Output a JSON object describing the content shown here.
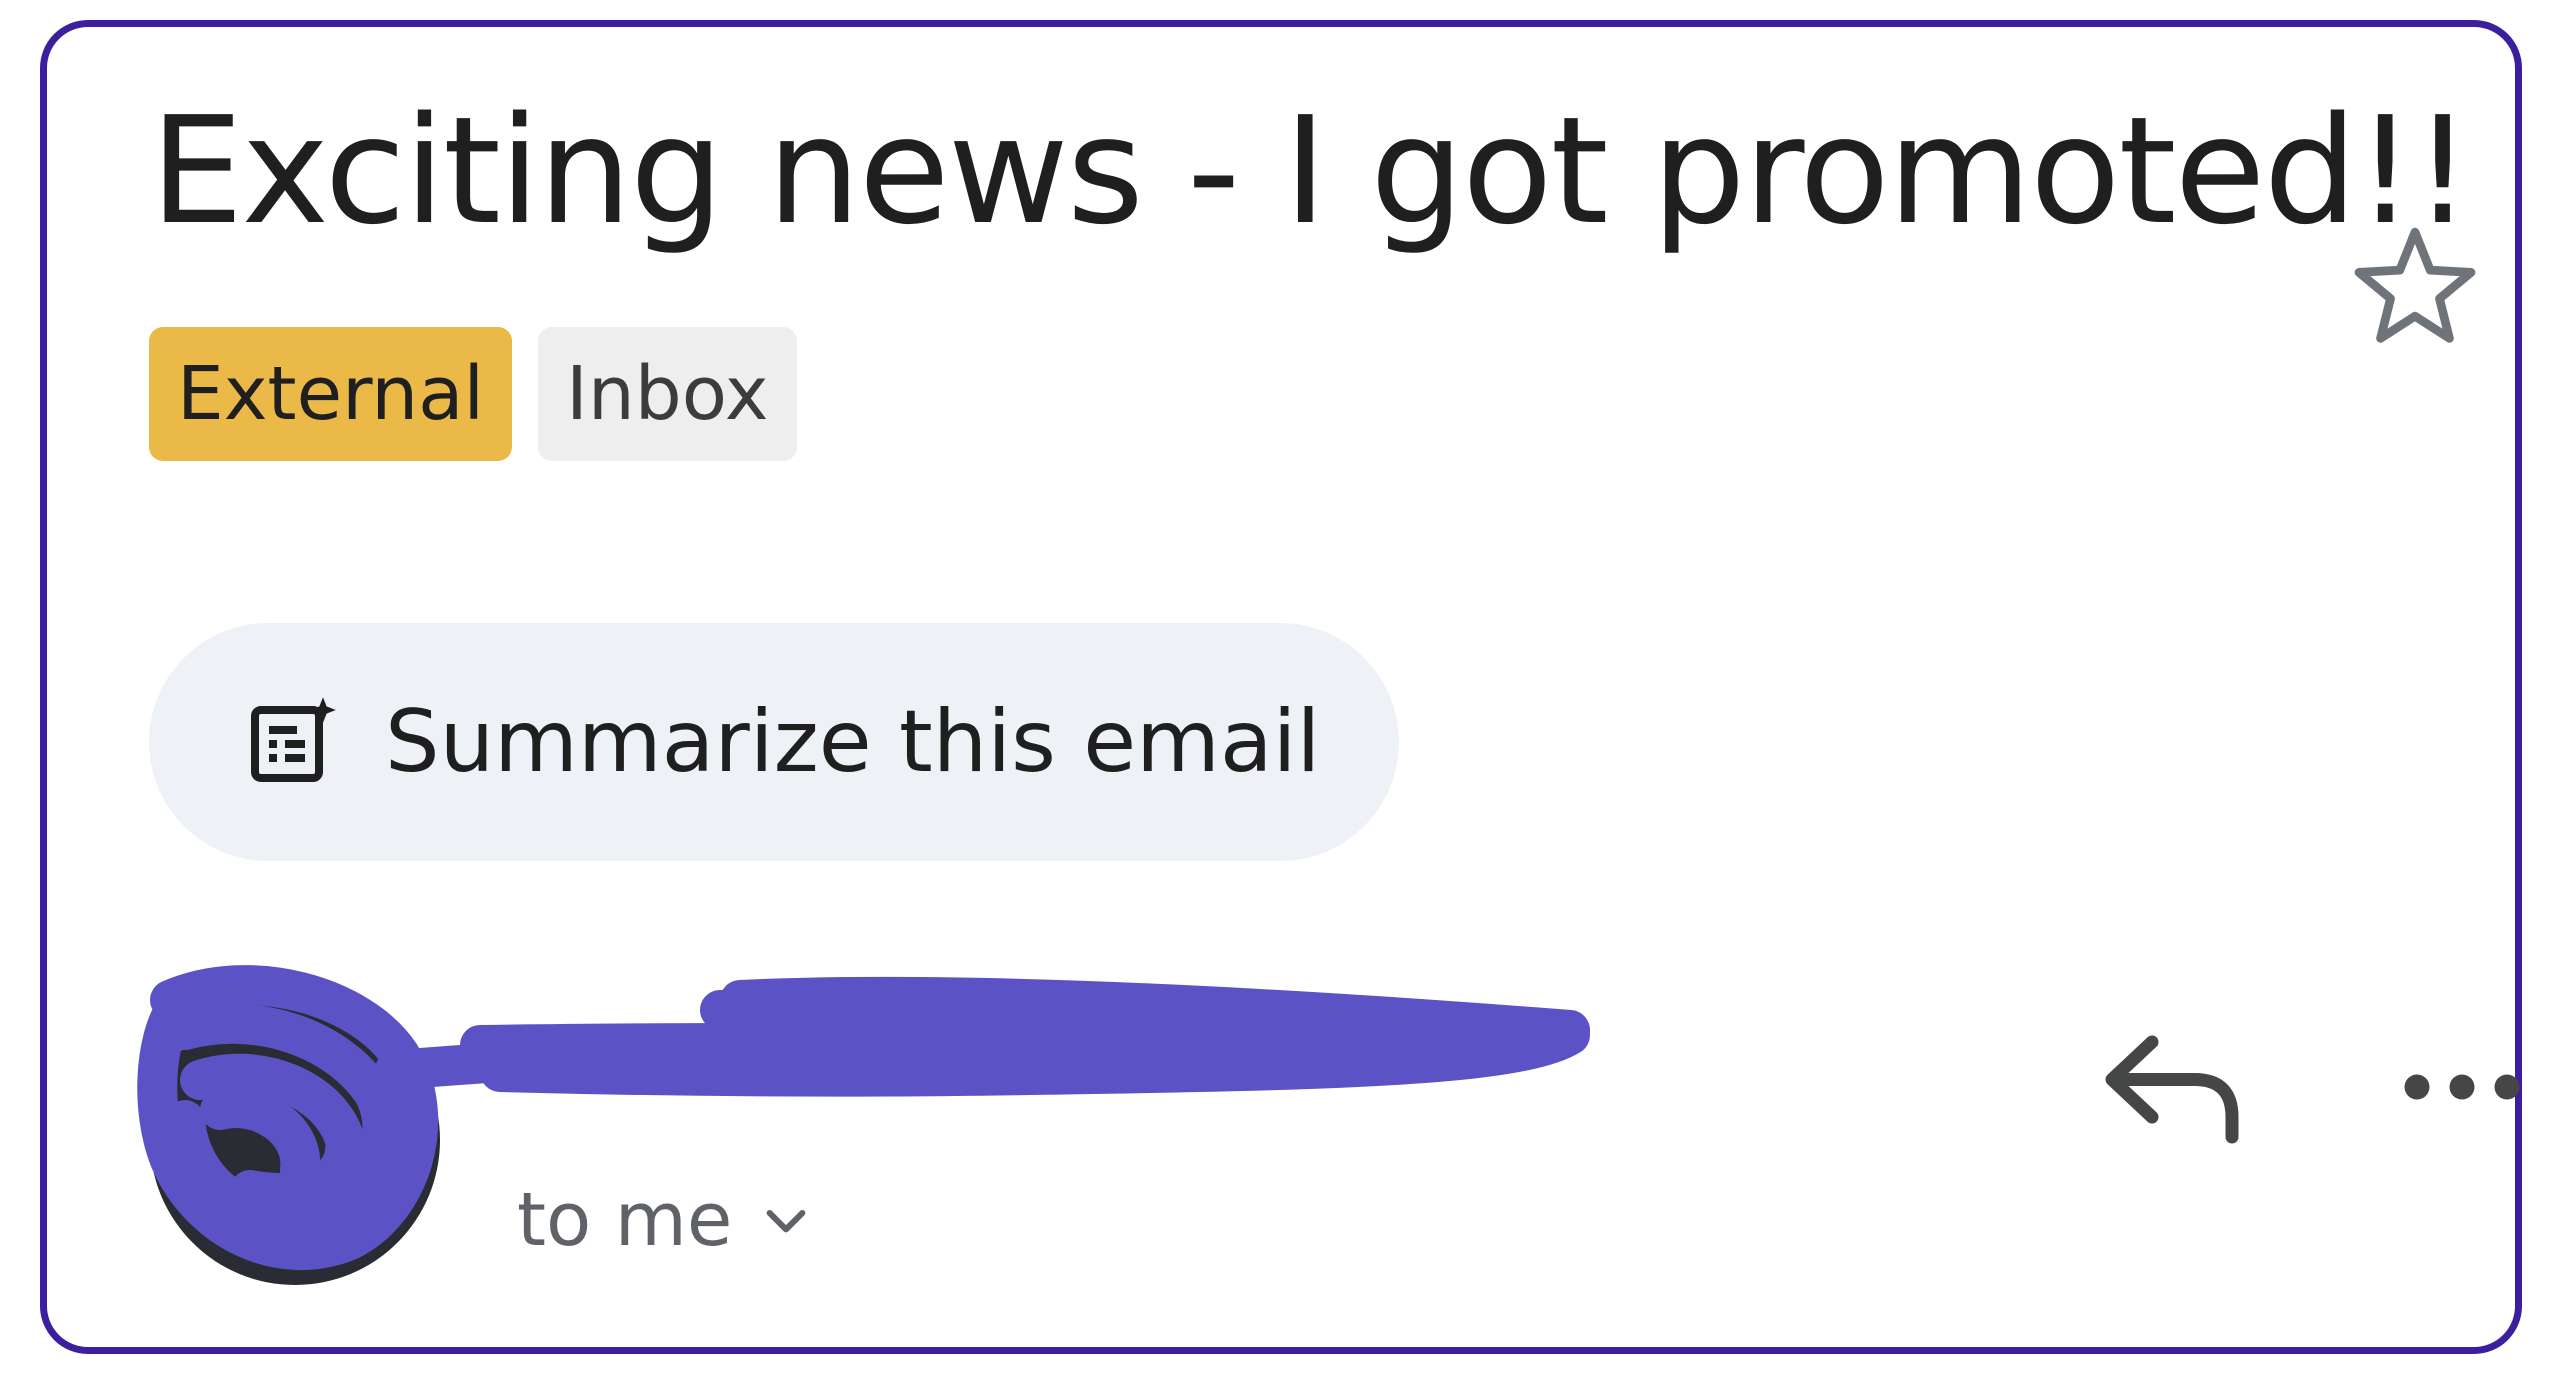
{
  "email": {
    "subject": "Exciting news - I got promoted!!",
    "labels": [
      "External",
      "Inbox"
    ],
    "summarize_label": "Summarize this email",
    "recipient_text": "to me"
  },
  "colors": {
    "frame_border": "#3b1f9e",
    "external_label_bg": "#ebb947",
    "inbox_label_bg": "#eeeeee",
    "summarize_bg": "#eef2f7",
    "redaction": "#5b52c6"
  },
  "icons": {
    "star": "star-outline-icon",
    "summarize": "summarize-sparkle-icon",
    "recipient_toggle": "chevron-down-icon",
    "reply": "reply-icon",
    "more": "more-horizontal-icon"
  }
}
